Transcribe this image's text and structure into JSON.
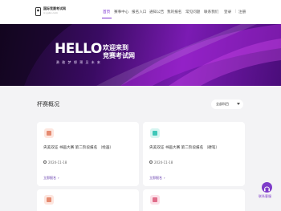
{
  "header": {
    "logo_title": "国际竞赛考试网",
    "logo_sub": "ic.yybc.com",
    "nav": [
      "首页",
      "赛事中心",
      "报名入口",
      "通知公告",
      "我的报名",
      "常见问题",
      "联系我们"
    ],
    "login": "登录",
    "separator": "|",
    "register": "注册"
  },
  "banner": {
    "hello": "HELLO",
    "line1": "欢迎来到",
    "line2": "竞赛考试网",
    "slogan": "勇 敢 梦 想    预 见 未 来"
  },
  "section": {
    "title": "杯赛概况",
    "filter_label": "全部科目"
  },
  "cards": [
    {
      "title": "央美双证 书画大赛 第二阶段报名 （绘画）",
      "date": "2024-11-18",
      "link": "立即报名",
      "icon_color": "#e58a70"
    },
    {
      "title": "央美双证 书画大赛 第二阶段报名 （硬笔）",
      "date": "2024-11-18",
      "link": "立即报名",
      "icon_color": "#3ec7b8"
    },
    {
      "title": "",
      "date": "",
      "link": "",
      "icon_color": "#e58a70"
    },
    {
      "title": "",
      "date": "",
      "link": "",
      "icon_color": "#e06d8a"
    }
  ],
  "floating": {
    "label": "联系客服"
  }
}
